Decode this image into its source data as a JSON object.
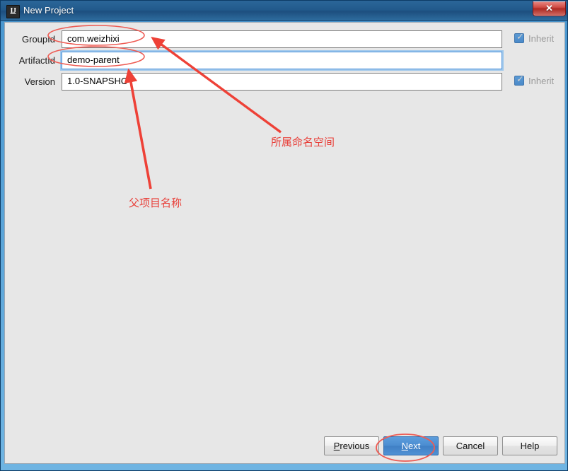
{
  "window": {
    "title": "New Project",
    "icon": "intellij-idea-icon",
    "close_label": "✕"
  },
  "form": {
    "rows": [
      {
        "label": "GroupId",
        "value": "com.weizhixi",
        "name": "groupid",
        "focused": false,
        "inherit": {
          "label": "Inherit",
          "checked": true,
          "enabled": false
        }
      },
      {
        "label": "ArtifactId",
        "value": "demo-parent",
        "name": "artifactid",
        "focused": true,
        "inherit": null
      },
      {
        "label": "Version",
        "value": "1.0-SNAPSHOT",
        "name": "version",
        "focused": false,
        "inherit": {
          "label": "Inherit",
          "checked": true,
          "enabled": false
        }
      }
    ]
  },
  "buttons": {
    "previous": {
      "prefix": "P",
      "rest": "revious"
    },
    "next": {
      "prefix": "N",
      "rest": "ext"
    },
    "cancel": {
      "label": "Cancel"
    },
    "help": {
      "label": "Help"
    }
  },
  "annotations": {
    "namespace_note": "所属命名空间",
    "parent_note": "父项目名称",
    "color": "#e8403a",
    "highlights": [
      {
        "target": "groupid-field",
        "shape": "ellipse"
      },
      {
        "target": "artifactid-field",
        "shape": "ellipse"
      },
      {
        "target": "next-button",
        "shape": "ellipse"
      }
    ],
    "arrows": [
      {
        "from": "namespace_note",
        "to": "groupid-field"
      },
      {
        "from": "parent_note",
        "to": "artifactid-field"
      }
    ]
  },
  "colors": {
    "titlebar": "#225a8c",
    "dialog_bg": "#e7e7e7",
    "accent": "#4a8cd0",
    "annotation": "#e8403a",
    "close": "#ae2a23"
  }
}
